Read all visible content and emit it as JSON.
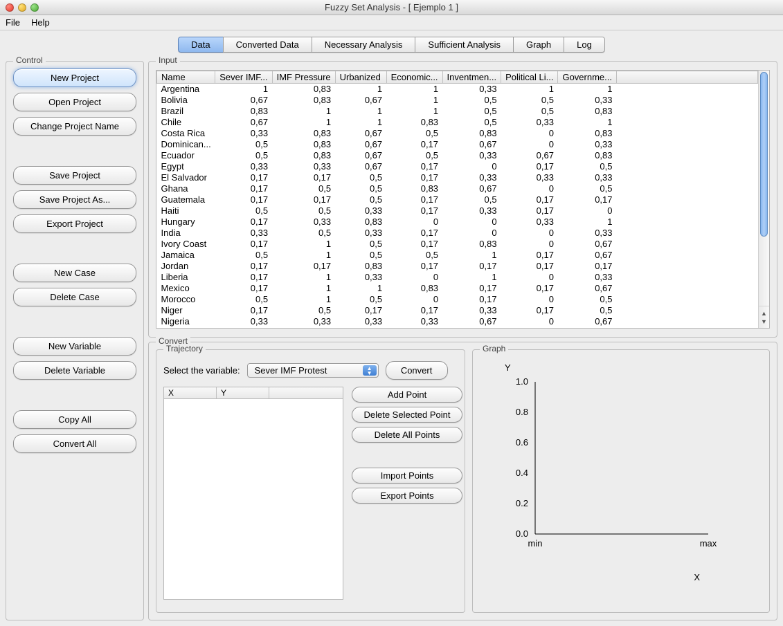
{
  "window": {
    "title": "Fuzzy Set Analysis - [ Ejemplo 1 ]"
  },
  "menu": {
    "file": "File",
    "help": "Help"
  },
  "tabs": [
    {
      "label": "Data",
      "active": true
    },
    {
      "label": "Converted Data",
      "active": false
    },
    {
      "label": "Necessary Analysis",
      "active": false
    },
    {
      "label": "Sufficient Analysis",
      "active": false
    },
    {
      "label": "Graph",
      "active": false
    },
    {
      "label": "Log",
      "active": false
    }
  ],
  "control": {
    "legend": "Control",
    "new_project": "New Project",
    "open_project": "Open Project",
    "change_name": "Change Project Name",
    "save_project": "Save Project",
    "save_as": "Save Project As...",
    "export_project": "Export Project",
    "new_case": "New Case",
    "delete_case": "Delete Case",
    "new_variable": "New Variable",
    "delete_variable": "Delete Variable",
    "copy_all": "Copy All",
    "convert_all": "Convert All"
  },
  "input": {
    "legend": "Input",
    "columns": [
      "Name",
      "Sever IMF...",
      "IMF Pressure",
      "Urbanized",
      "Economic...",
      "Inventmen...",
      "Political Li...",
      "Governme..."
    ],
    "rows": [
      [
        "Argentina",
        "1",
        "0,83",
        "1",
        "1",
        "0,33",
        "1",
        "1"
      ],
      [
        "Bolivia",
        "0,67",
        "0,83",
        "0,67",
        "1",
        "0,5",
        "0,5",
        "0,33"
      ],
      [
        "Brazil",
        "0,83",
        "1",
        "1",
        "1",
        "0,5",
        "0,5",
        "0,83"
      ],
      [
        "Chile",
        "0,67",
        "1",
        "1",
        "0,83",
        "0,5",
        "0,33",
        "1"
      ],
      [
        "Costa Rica",
        "0,33",
        "0,83",
        "0,67",
        "0,5",
        "0,83",
        "0",
        "0,83"
      ],
      [
        "Dominican...",
        "0,5",
        "0,83",
        "0,67",
        "0,17",
        "0,67",
        "0",
        "0,33"
      ],
      [
        "Ecuador",
        "0,5",
        "0,83",
        "0,67",
        "0,5",
        "0,33",
        "0,67",
        "0,83"
      ],
      [
        "Egypt",
        "0,33",
        "0,33",
        "0,67",
        "0,17",
        "0",
        "0,17",
        "0,5"
      ],
      [
        "El Salvador",
        "0,17",
        "0,17",
        "0,5",
        "0,17",
        "0,33",
        "0,33",
        "0,33"
      ],
      [
        "Ghana",
        "0,17",
        "0,5",
        "0,5",
        "0,83",
        "0,67",
        "0",
        "0,5"
      ],
      [
        "Guatemala",
        "0,17",
        "0,17",
        "0,5",
        "0,17",
        "0,5",
        "0,17",
        "0,17"
      ],
      [
        "Haiti",
        "0,5",
        "0,5",
        "0,33",
        "0,17",
        "0,33",
        "0,17",
        "0"
      ],
      [
        "Hungary",
        "0,17",
        "0,33",
        "0,83",
        "0",
        "0",
        "0,33",
        "1"
      ],
      [
        "India",
        "0,33",
        "0,5",
        "0,33",
        "0,17",
        "0",
        "0",
        "0,33"
      ],
      [
        "Ivory Coast",
        "0,17",
        "1",
        "0,5",
        "0,17",
        "0,83",
        "0",
        "0,67"
      ],
      [
        "Jamaica",
        "0,5",
        "1",
        "0,5",
        "0,5",
        "1",
        "0,17",
        "0,67"
      ],
      [
        "Jordan",
        "0,17",
        "0,17",
        "0,83",
        "0,17",
        "0,17",
        "0,17",
        "0,17"
      ],
      [
        "Liberia",
        "0,17",
        "1",
        "0,33",
        "0",
        "1",
        "0",
        "0,33"
      ],
      [
        "Mexico",
        "0,17",
        "1",
        "1",
        "0,83",
        "0,17",
        "0,17",
        "0,67"
      ],
      [
        "Morocco",
        "0,5",
        "1",
        "0,5",
        "0",
        "0,17",
        "0",
        "0,5"
      ],
      [
        "Niger",
        "0,17",
        "0,5",
        "0,17",
        "0,17",
        "0,33",
        "0,17",
        "0,5"
      ],
      [
        "Nigeria",
        "0,33",
        "0,33",
        "0,33",
        "0,33",
        "0,67",
        "0",
        "0,67"
      ]
    ]
  },
  "convert": {
    "legend": "Convert",
    "trajectory": {
      "legend": "Trajectory",
      "select_label": "Select the variable:",
      "selected": "Sever IMF Protest",
      "convert_btn": "Convert",
      "xy_headers": {
        "x": "X",
        "y": "Y"
      },
      "add_point": "Add Point",
      "del_sel": "Delete Selected Point",
      "del_all": "Delete All Points",
      "import": "Import Points",
      "export": "Export Points"
    },
    "graph": {
      "legend": "Graph",
      "ylabel": "Y",
      "xlabel": "X",
      "xmin": "min",
      "xmax": "max"
    }
  },
  "chart_data": {
    "type": "line",
    "title": "",
    "xlabel": "X",
    "ylabel": "Y",
    "xlim": [
      "min",
      "max"
    ],
    "ylim": [
      0.0,
      1.0
    ],
    "y_ticks": [
      0.0,
      0.2,
      0.4,
      0.6,
      0.8,
      1.0
    ],
    "series": []
  }
}
